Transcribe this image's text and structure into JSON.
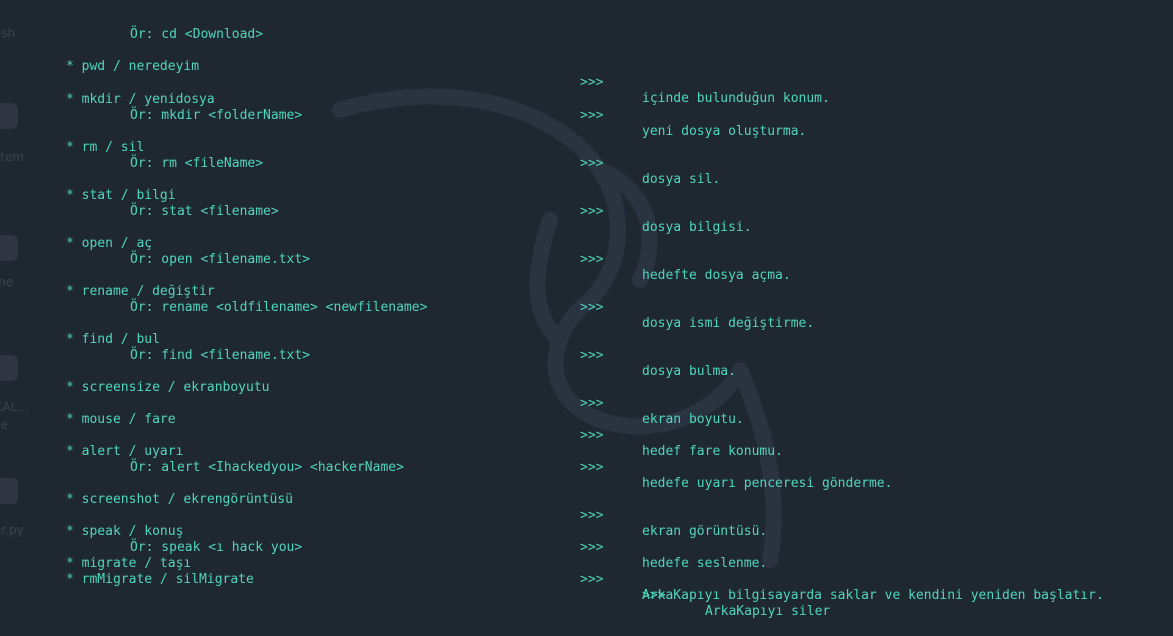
{
  "colors": {
    "background": "#1f2731",
    "text": "#4fd6be"
  },
  "separator": ">>>",
  "top_example": "Ör: cd <Download>",
  "commands": [
    {
      "cmd": "* pwd / neredeyim",
      "desc": "içinde bulunduğun konum.",
      "example": ""
    },
    {
      "cmd": "* mkdir / yenidosya",
      "desc": "yeni dosya oluşturma.",
      "example": "Ör: mkdir <folderName>"
    },
    {
      "cmd": "* rm / sil",
      "desc": "dosya sil.",
      "example": "Ör: rm <fileName>"
    },
    {
      "cmd": "* stat / bilgi",
      "desc": "dosya bilgisi.",
      "example": "Ör: stat <filename>"
    },
    {
      "cmd": "* open / aç",
      "desc": "hedefte dosya açma.",
      "example": "Ör: open <filename.txt>"
    },
    {
      "cmd": "* rename / değiştir",
      "desc": "dosya ismi değiştirme.",
      "example": "Ör: rename <oldfilename> <newfilename>"
    },
    {
      "cmd": "* find / bul",
      "desc": "dosya bulma.",
      "example": "Ör: find <filename.txt>"
    },
    {
      "cmd": "* screensize / ekranboyutu",
      "desc": "ekran boyutu.",
      "example": ""
    },
    {
      "cmd": "* mouse / fare",
      "desc": "hedef fare konumu.",
      "example": ""
    },
    {
      "cmd": "* alert / uyarı",
      "desc": "hedefe uyarı penceresi gönderme.",
      "example": "Ör: alert <Ihackedyou> <hackerName>"
    },
    {
      "cmd": "* screenshot / ekrengörüntüsü",
      "desc": "ekran görüntüsü.",
      "example": ""
    },
    {
      "cmd": "* speak / konuş",
      "desc": "hedefe seslenme.",
      "example": "Ör: speak <ı hack you>"
    },
    {
      "cmd": "* migrate / taşı",
      "desc": "ArkaKapıyı bilgisayarda saklar ve kendini yeniden başlatır.",
      "example": ""
    },
    {
      "cmd": "* rmMigrate / silMigrate",
      "desc": "ArkaKapıyı siler",
      "example": ""
    }
  ],
  "desktop_labels": [
    "ash",
    "stem",
    "me",
    "CAL...",
    "ce",
    "er.py"
  ]
}
